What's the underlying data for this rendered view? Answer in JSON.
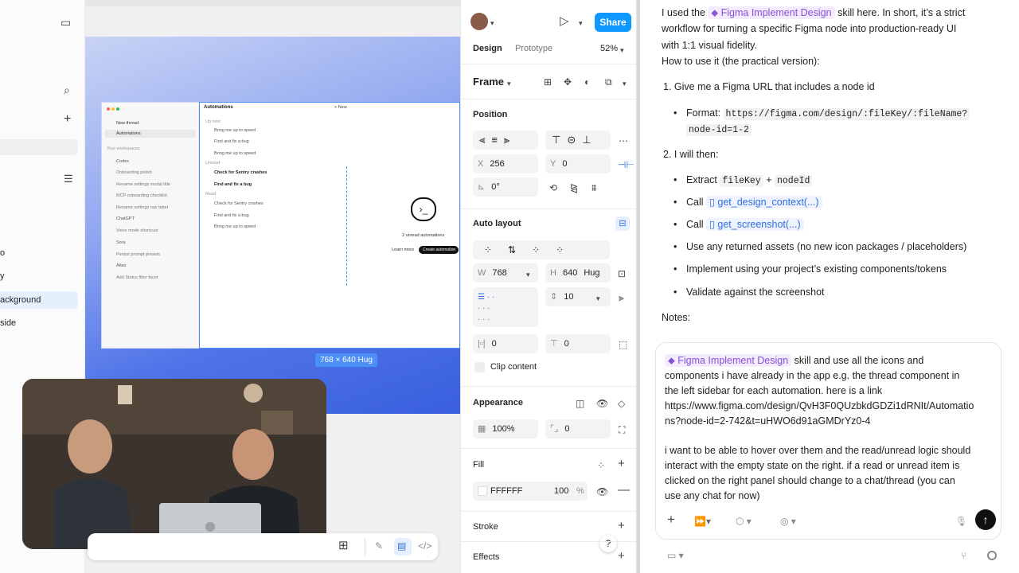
{
  "left_panel": {
    "items": [
      "o",
      "y",
      "ackground",
      "side"
    ]
  },
  "canvas": {
    "mock": {
      "sidebar_items": [
        "New thread",
        "Automations",
        "Your workspaces",
        "Codex",
        "Onboarding polish",
        "Rename settings modal title",
        "MCP onboarding checklist",
        "Rename settings nav label",
        "ChatGPT",
        "Voice mode shortcuts",
        "Sora",
        "Persist prompt presets",
        "Atlas",
        "Add Status filter facet"
      ],
      "title": "Automations",
      "new_label": "+ New",
      "groups": [
        "Up next",
        "Unread",
        "Read"
      ],
      "rows": [
        "Bring me up to speed",
        "Find and fix a bug",
        "Bring me up to speed",
        "Check for Sentry crashes",
        "Find and fix a bug",
        "Check for Sentry crashes",
        "Find and fix a bug",
        "Bring me up to speed"
      ],
      "empty_text": "2 unread automations",
      "learn_more": "Learn more",
      "create": "Create automation"
    },
    "dim_label": "768 × 640 Hug"
  },
  "design_panel": {
    "tabs": [
      "Design",
      "Prototype"
    ],
    "zoom": "52%",
    "share": "Share",
    "frame_label": "Frame",
    "position": {
      "title": "Position",
      "x_label": "X",
      "x": "256",
      "y_label": "Y",
      "y": "0",
      "rotation": "0°"
    },
    "auto_layout": {
      "title": "Auto layout",
      "w_label": "W",
      "w": "768",
      "h_label": "H",
      "h": "640",
      "hug": "Hug",
      "gap": "10",
      "pad1": "0",
      "pad2": "0",
      "clip": "Clip content"
    },
    "appearance": {
      "title": "Appearance",
      "opacity": "100%",
      "radius": "0"
    },
    "fill": {
      "title": "Fill",
      "hex": "FFFFFF",
      "opacity": "100",
      "pct": "%"
    },
    "stroke": "Stroke",
    "effects": "Effects",
    "help": "?"
  },
  "chat": {
    "intro_a": "I used the",
    "skill": "Figma Implement Design",
    "intro_b": "skill here. In short, it’s a strict",
    "intro_c": "workflow for turning a specific Figma node into production-ready UI",
    "intro_d": "with 1:1 visual fidelity.",
    "how": "How to use it (the practical version):",
    "step1": "1. Give me a Figma URL that includes a node id",
    "format_label": "Format:",
    "format_a": "https://figma.com/design/:fileKey/:fileName?",
    "format_b": "node-id=1-2",
    "step2": "2. I will then:",
    "extract": "Extract",
    "filekey": "fileKey",
    "plus": "+",
    "nodeid": "nodeId",
    "call": "Call",
    "call1": "get_design_context(...)",
    "call2": "get_screenshot(...)",
    "b3": "Use any returned assets (no new icon packages / placeholders)",
    "b4": "Implement using your project’s existing components/tokens",
    "b5": "Validate against the screenshot",
    "notes": "Notes:"
  },
  "composer": {
    "skill": "Figma Implement Design",
    "l1": "skill and use all the icons and",
    "l2": "components i have already in the app e.g. the thread component in",
    "l3": "the left sidebar for each automation. here is a link",
    "l4": "https://www.figma.com/design/QvH3F0QUzbkdGDZi1dRNIt/Automatio",
    "l5": "ns?node-id=2-742&t=uHWO6d91aGMDrYz0-4",
    "l6": "i want to be able to hover over them and the read/unread logic should",
    "l7": "interact with the empty state on the right. if a read or unread item is",
    "l8": "clicked on the right panel should change to a chat/thread (you can",
    "l9": "use any chat for now)"
  }
}
